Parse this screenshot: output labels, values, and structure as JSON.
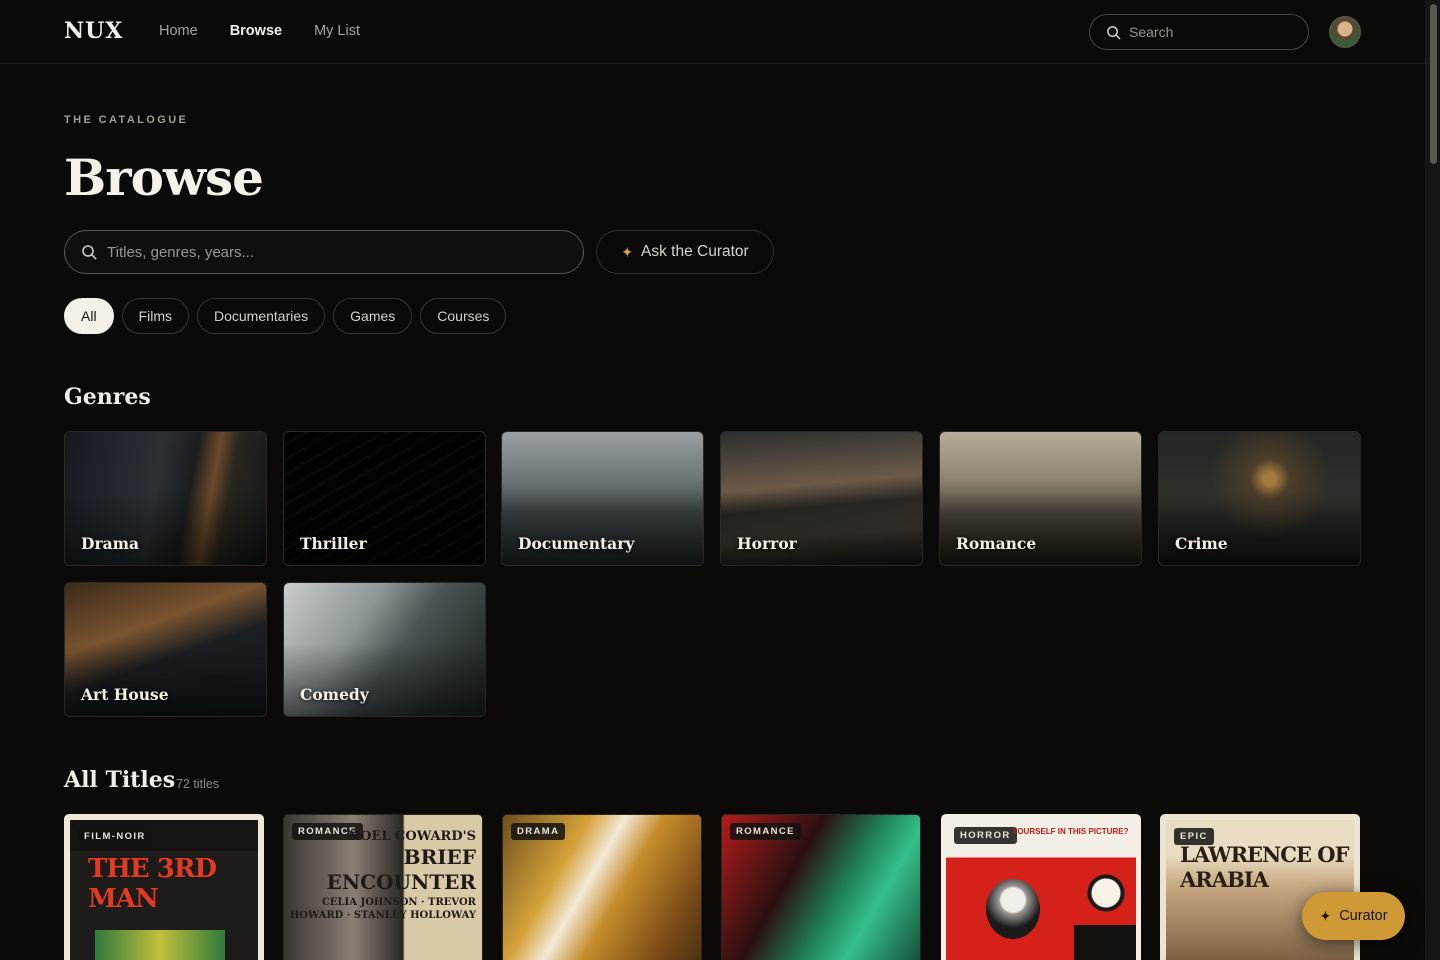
{
  "app": {
    "logo": "NUX"
  },
  "nav": {
    "items": [
      "Home",
      "Browse",
      "My List"
    ],
    "active": "Browse"
  },
  "top_search": {
    "placeholder": "Search"
  },
  "hero": {
    "eyebrow": "THE CATALOGUE",
    "title": "Browse",
    "search_placeholder": "Titles, genres, years...",
    "curator_label": "Ask the Curator"
  },
  "filters": [
    "All",
    "Films",
    "Documentaries",
    "Games",
    "Courses"
  ],
  "genres": {
    "title": "Genres",
    "items": [
      "Drama",
      "Thriller",
      "Documentary",
      "Horror",
      "Romance",
      "Crime",
      "Art House",
      "Comedy"
    ]
  },
  "all_titles": {
    "title": "All Titles",
    "count": "72 titles",
    "posters": [
      {
        "badge": "FILM-NOIR",
        "title": "THE 3RD MAN"
      },
      {
        "badge": "ROMANCE",
        "title_top": "NOEL COWARD'S",
        "title": "BRIEF ENCOUNTER",
        "cast": "CELIA JOHNSON · TREVOR HOWARD · STANLEY HOLLOWAY"
      },
      {
        "badge": "DRAMA"
      },
      {
        "badge": "ROMANCE"
      },
      {
        "badge": "HORROR",
        "headline": "YOURSELF IN THIS PICTURE?"
      },
      {
        "badge": "EPIC",
        "title": "LAWRENCE OF ARABIA"
      }
    ]
  },
  "float_button": {
    "label": "Curator"
  },
  "colors": {
    "accent": "#cf9a36",
    "background": "#0b0a09"
  }
}
